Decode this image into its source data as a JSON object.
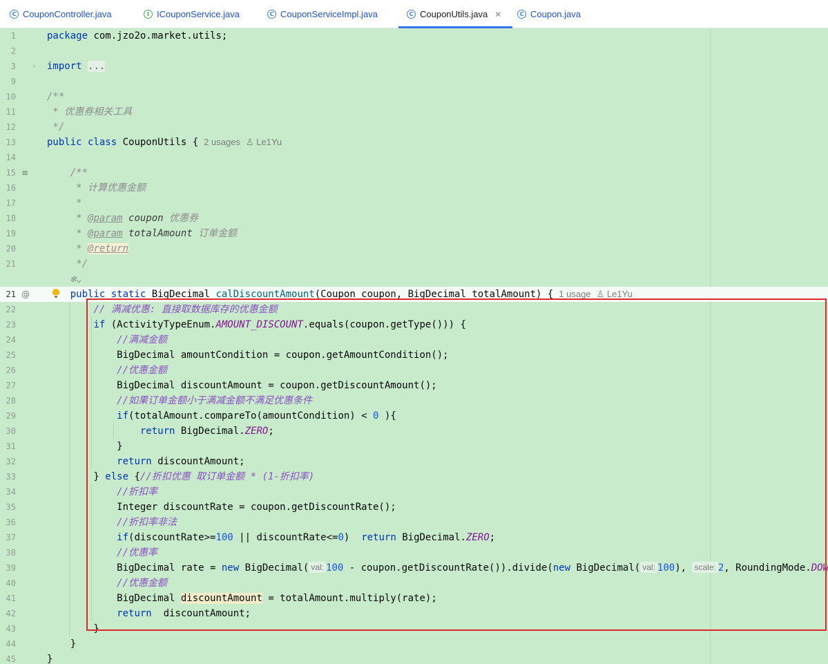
{
  "tabs": [
    {
      "label": "CouponController.java",
      "icon": "class-icon",
      "active": false
    },
    {
      "label": "ICouponService.java",
      "icon": "interface-icon",
      "active": false
    },
    {
      "label": "CouponServiceImpl.java",
      "icon": "class-icon",
      "active": false
    },
    {
      "label": "CouponUtils.java",
      "icon": "class-icon",
      "active": true
    },
    {
      "label": "Coupon.java",
      "icon": "class-icon",
      "active": false
    }
  ],
  "editor": {
    "highlight_box_color": "#e0282a",
    "background_color": "#c8ebcc",
    "current_line": "21",
    "lines": [
      {
        "n": "1",
        "tokens": [
          [
            "kw",
            "package"
          ],
          [
            "p",
            " com.jzo2o.market.utils;"
          ]
        ]
      },
      {
        "n": "2",
        "tokens": []
      },
      {
        "n": "3",
        "tokens": [
          [
            "kw",
            "import"
          ],
          [
            "p",
            " "
          ],
          [
            "fold",
            "..."
          ]
        ],
        "fold": "collapsed"
      },
      {
        "n": "9",
        "tokens": []
      },
      {
        "n": "10",
        "tokens": [
          [
            "cm",
            "/**"
          ]
        ]
      },
      {
        "n": "11",
        "tokens": [
          [
            "cm",
            " * 优惠券相关工具"
          ]
        ]
      },
      {
        "n": "12",
        "tokens": [
          [
            "cm",
            " */"
          ]
        ]
      },
      {
        "n": "13",
        "tokens": [
          [
            "kw",
            "public class"
          ],
          [
            "p",
            " CouponUtils {"
          ]
        ],
        "meta": [
          "2 usages",
          "Le1Yu"
        ]
      },
      {
        "n": "14",
        "tokens": []
      },
      {
        "n": "15",
        "tokens": [
          [
            "p",
            "    "
          ],
          [
            "cm",
            "/**"
          ]
        ],
        "gutter": "doc-icon"
      },
      {
        "n": "16",
        "tokens": [
          [
            "p",
            "     "
          ],
          [
            "cm",
            "* 计算优惠金额"
          ]
        ]
      },
      {
        "n": "17",
        "tokens": [
          [
            "p",
            "     "
          ],
          [
            "cm",
            "*"
          ]
        ]
      },
      {
        "n": "18",
        "tokens": [
          [
            "p",
            "     "
          ],
          [
            "cm",
            "* "
          ],
          [
            "tag",
            "@param"
          ],
          [
            "p",
            " "
          ],
          [
            "param",
            "coupon"
          ],
          [
            "cm",
            " 优惠券"
          ]
        ]
      },
      {
        "n": "19",
        "tokens": [
          [
            "p",
            "     "
          ],
          [
            "cm",
            "* "
          ],
          [
            "tag",
            "@param"
          ],
          [
            "p",
            " "
          ],
          [
            "param",
            "totalAmount"
          ],
          [
            "cm",
            " 订单金额"
          ]
        ]
      },
      {
        "n": "20",
        "tokens": [
          [
            "p",
            "     "
          ],
          [
            "cm",
            "* "
          ],
          [
            "taghl",
            "@return"
          ]
        ]
      },
      {
        "n": "21",
        "tokens": [
          [
            "p",
            "     "
          ],
          [
            "cm",
            "*/"
          ]
        ]
      },
      {
        "n": "",
        "tokens": [
          [
            "p",
            "    "
          ],
          [
            "cm",
            "❇⌄"
          ]
        ]
      },
      {
        "n": "21",
        "tokens": [
          [
            "p",
            "    "
          ],
          [
            "kw",
            "public static"
          ],
          [
            "p",
            " BigDecimal "
          ],
          [
            "fn",
            "calDiscountAmount"
          ],
          [
            "p",
            "(Coupon coupon, BigDecimal totalAmount) {"
          ]
        ],
        "meta": [
          "1 usage",
          "Le1Yu"
        ],
        "gutter": "override-icon",
        "bulb": true,
        "current": true
      },
      {
        "n": "22",
        "tokens": [
          [
            "p",
            "        "
          ],
          [
            "lc",
            "// 满减优惠: 直接取数据库存的优惠金额"
          ]
        ]
      },
      {
        "n": "23",
        "tokens": [
          [
            "p",
            "        "
          ],
          [
            "kw",
            "if"
          ],
          [
            "p",
            " (ActivityTypeEnum."
          ],
          [
            "st",
            "AMOUNT_DISCOUNT"
          ],
          [
            "p",
            ".equals(coupon.getType())) {"
          ]
        ]
      },
      {
        "n": "24",
        "tokens": [
          [
            "p",
            "            "
          ],
          [
            "lc",
            "//满减金额"
          ]
        ]
      },
      {
        "n": "25",
        "tokens": [
          [
            "p",
            "            BigDecimal amountCondition = coupon.getAmountCondition();"
          ]
        ]
      },
      {
        "n": "26",
        "tokens": [
          [
            "p",
            "            "
          ],
          [
            "lc",
            "//优惠金额"
          ]
        ]
      },
      {
        "n": "27",
        "tokens": [
          [
            "p",
            "            BigDecimal discountAmount = coupon.getDiscountAmount();"
          ]
        ]
      },
      {
        "n": "28",
        "tokens": [
          [
            "p",
            "            "
          ],
          [
            "lc",
            "//如果订单金额小于满减金额不满足优惠条件"
          ]
        ]
      },
      {
        "n": "29",
        "tokens": [
          [
            "p",
            "            "
          ],
          [
            "kw",
            "if"
          ],
          [
            "p",
            "(totalAmount.compareTo(amountCondition) < "
          ],
          [
            "num",
            "0"
          ],
          [
            "p",
            " ){"
          ]
        ]
      },
      {
        "n": "30",
        "tokens": [
          [
            "p",
            "                "
          ],
          [
            "kw",
            "return"
          ],
          [
            "p",
            " BigDecimal."
          ],
          [
            "st",
            "ZERO"
          ],
          [
            "p",
            ";"
          ]
        ]
      },
      {
        "n": "31",
        "tokens": [
          [
            "p",
            "            }"
          ]
        ]
      },
      {
        "n": "32",
        "tokens": [
          [
            "p",
            "            "
          ],
          [
            "kw",
            "return"
          ],
          [
            "p",
            " discountAmount;"
          ]
        ]
      },
      {
        "n": "33",
        "tokens": [
          [
            "p",
            "        } "
          ],
          [
            "kw",
            "else"
          ],
          [
            "p",
            " {"
          ],
          [
            "lc",
            "//折扣优惠 取订单金额 * (1-折扣率)"
          ]
        ]
      },
      {
        "n": "34",
        "tokens": [
          [
            "p",
            "            "
          ],
          [
            "lc",
            "//折扣率"
          ]
        ]
      },
      {
        "n": "35",
        "tokens": [
          [
            "p",
            "            Integer discountRate = coupon.getDiscountRate();"
          ]
        ]
      },
      {
        "n": "36",
        "tokens": [
          [
            "p",
            "            "
          ],
          [
            "lc",
            "//折扣率非法"
          ]
        ]
      },
      {
        "n": "37",
        "tokens": [
          [
            "p",
            "            "
          ],
          [
            "kw",
            "if"
          ],
          [
            "p",
            "(discountRate>="
          ],
          [
            "num",
            "100"
          ],
          [
            "p",
            " || discountRate<="
          ],
          [
            "num",
            "0"
          ],
          [
            "p",
            ")  "
          ],
          [
            "kw",
            "return"
          ],
          [
            "p",
            " BigDecimal."
          ],
          [
            "st",
            "ZERO"
          ],
          [
            "p",
            ";"
          ]
        ]
      },
      {
        "n": "38",
        "tokens": [
          [
            "p",
            "            "
          ],
          [
            "lc",
            "//优惠率"
          ]
        ]
      },
      {
        "n": "39",
        "tokens": [
          [
            "p",
            "            BigDecimal rate = "
          ],
          [
            "kw",
            "new"
          ],
          [
            "p",
            " BigDecimal("
          ],
          [
            "hint",
            "val:"
          ],
          [
            "num",
            "100"
          ],
          [
            "p",
            " - coupon.getDiscountRate()).divide("
          ],
          [
            "kw",
            "new"
          ],
          [
            "p",
            " BigDecimal("
          ],
          [
            "hint",
            "val:"
          ],
          [
            "num",
            "100"
          ],
          [
            "p",
            "), "
          ],
          [
            "hint",
            "scale:"
          ],
          [
            "num",
            "2"
          ],
          [
            "p",
            ", RoundingMode."
          ],
          [
            "st",
            "DOWN"
          ],
          [
            "p",
            ");"
          ]
        ]
      },
      {
        "n": "40",
        "tokens": [
          [
            "p",
            "            "
          ],
          [
            "lc",
            "//优惠金额"
          ]
        ]
      },
      {
        "n": "41",
        "tokens": [
          [
            "p",
            "            BigDecimal "
          ],
          [
            "hlv",
            "discountAmount"
          ],
          [
            "p",
            " = totalAmount.multiply(rate);"
          ]
        ]
      },
      {
        "n": "42",
        "tokens": [
          [
            "p",
            "            "
          ],
          [
            "kw",
            "return"
          ],
          [
            "p",
            "  discountAmount;"
          ]
        ]
      },
      {
        "n": "43",
        "tokens": [
          [
            "p",
            "        }"
          ]
        ]
      },
      {
        "n": "44",
        "tokens": [
          [
            "p",
            "    }"
          ]
        ]
      },
      {
        "n": "45",
        "tokens": [
          [
            "p",
            "}"
          ]
        ]
      }
    ]
  }
}
